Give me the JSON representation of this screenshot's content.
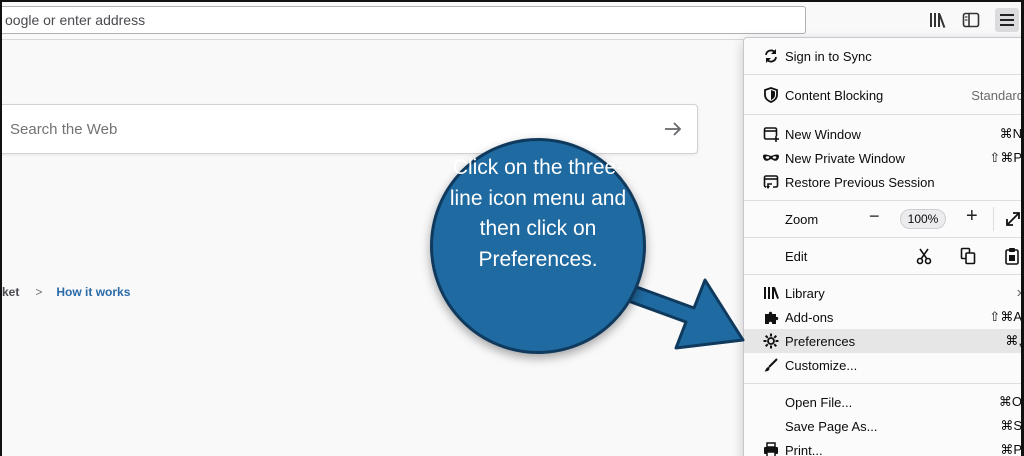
{
  "toolbar": {
    "url_placeholder": "oogle or enter address",
    "icons": [
      "library-icon",
      "sidebar-icon",
      "hamburger-menu-icon"
    ]
  },
  "newtab": {
    "search_placeholder": "Search the Web",
    "pocket_label": "ket",
    "pocket_link": "How it works"
  },
  "menu": {
    "sign_in": "Sign in to Sync",
    "content_blocking": "Content Blocking",
    "content_blocking_value": "Standard",
    "new_window": "New Window",
    "new_window_sc": "⌘N",
    "new_private": "New Private Window",
    "new_private_sc": "⇧⌘P",
    "restore": "Restore Previous Session",
    "zoom": "Zoom",
    "zoom_minus": "−",
    "zoom_value": "100%",
    "zoom_plus": "+",
    "edit": "Edit",
    "library": "Library",
    "library_sc": "›",
    "addons": "Add-ons",
    "addons_sc": "⇧⌘A",
    "preferences": "Preferences",
    "preferences_sc": "⌘,",
    "customize": "Customize...",
    "open_file": "Open File...",
    "open_file_sc": "⌘O",
    "save_page": "Save Page As...",
    "save_page_sc": "⌘S",
    "print": "Print...",
    "print_sc": "⌘P"
  },
  "callout": {
    "text": "Click on the three-line icon menu and then click on Preferences."
  },
  "colors": {
    "callout_fill": "#1f6aa0",
    "menu_highlight": "#e6e6e6",
    "link": "#2a6aa8"
  }
}
